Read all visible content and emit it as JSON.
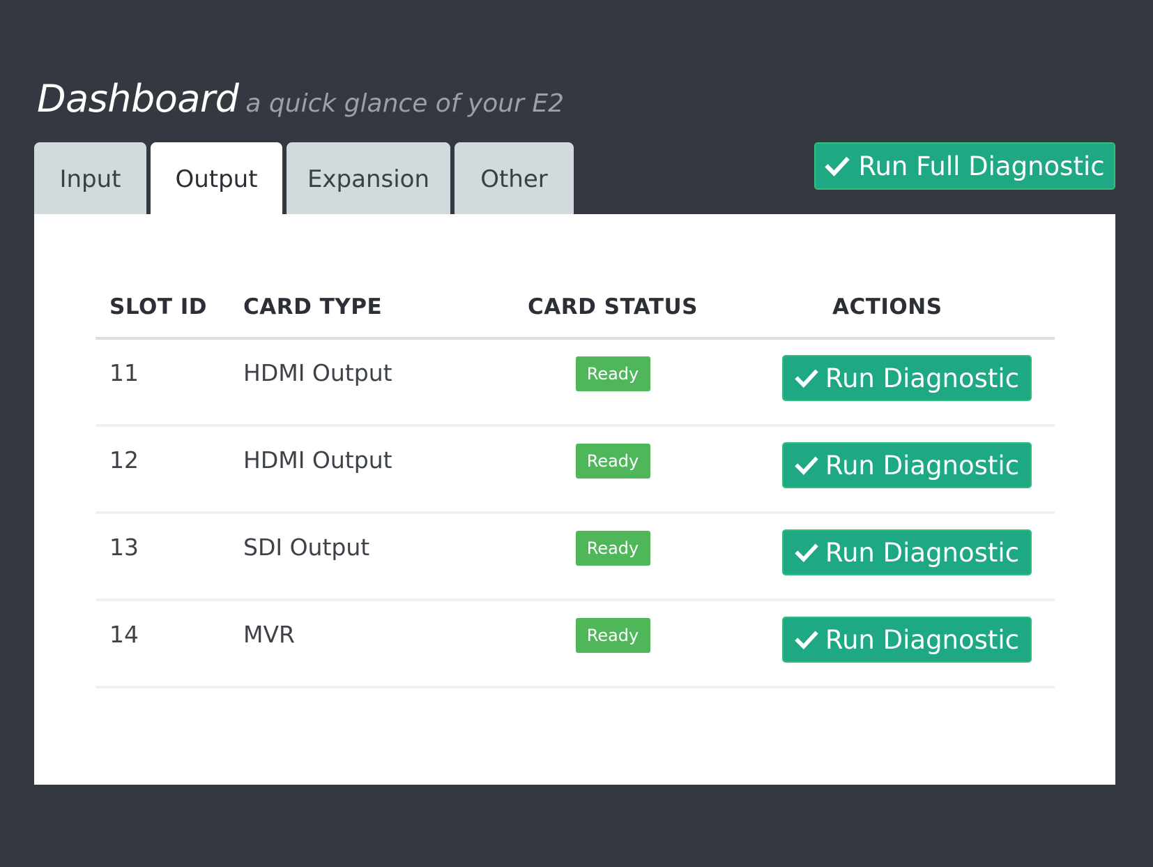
{
  "header": {
    "title": "Dashboard",
    "subtitle": "a quick glance of your E2"
  },
  "tabs": [
    {
      "label": "Input",
      "active": false
    },
    {
      "label": "Output",
      "active": true
    },
    {
      "label": "Expansion",
      "active": false
    },
    {
      "label": "Other",
      "active": false
    }
  ],
  "toolbar": {
    "full_diagnostic_label": "Run Full Diagnostic",
    "full_diagnostic_icon": "check-icon"
  },
  "table": {
    "columns": [
      "SLOT ID",
      "CARD TYPE",
      "CARD STATUS",
      "ACTIONS"
    ],
    "rows": [
      {
        "slot_id": "11",
        "card_type": "HDMI Output",
        "status": "Ready",
        "action": "Run Diagnostic"
      },
      {
        "slot_id": "12",
        "card_type": "HDMI Output",
        "status": "Ready",
        "action": "Run Diagnostic"
      },
      {
        "slot_id": "13",
        "card_type": "SDI Output",
        "status": "Ready",
        "action": "Run Diagnostic"
      },
      {
        "slot_id": "14",
        "card_type": "MVR",
        "status": "Ready",
        "action": "Run Diagnostic"
      }
    ]
  },
  "colors": {
    "background": "#343840",
    "accent": "#1fa884",
    "status_ready": "#4fb65a",
    "tab_inactive": "#d2dade"
  }
}
